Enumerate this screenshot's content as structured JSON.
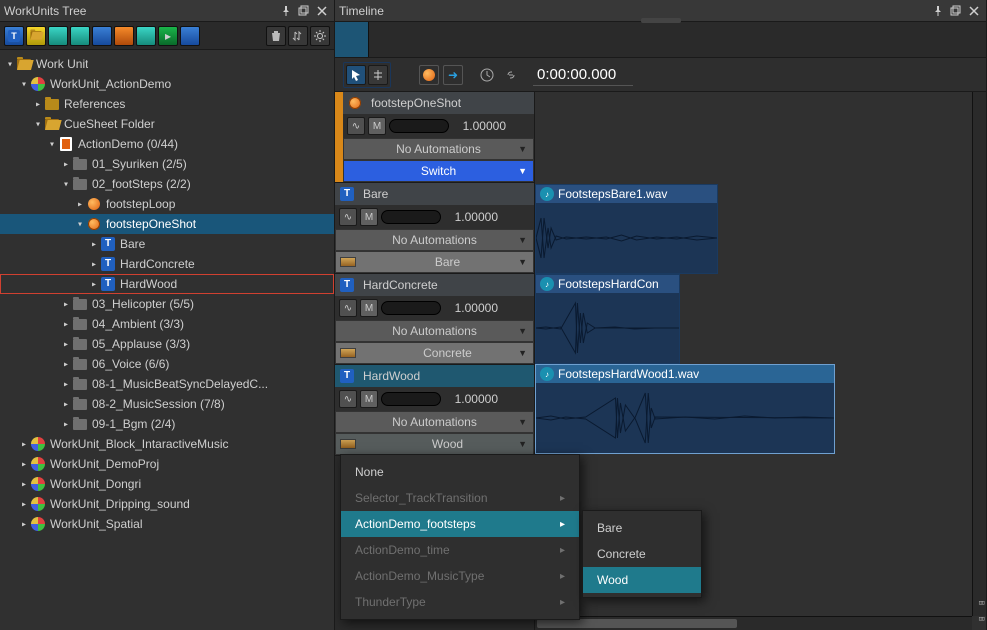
{
  "left": {
    "title": "WorkUnits Tree",
    "tree": {
      "root": "Work Unit",
      "wu_action": "WorkUnit_ActionDemo",
      "references": "References",
      "cuesheet": "CueSheet Folder",
      "actiondemo": "ActionDemo (0/44)",
      "actiondemo_name": "ActionDemo",
      "items": {
        "syuriken": "01_Syuriken (2/5)",
        "footsteps": "02_footSteps (2/2)",
        "footstepLoop": "footstepLoop",
        "footstepOneShot": "footstepOneShot",
        "bare": "Bare",
        "hardConcrete": "HardConcrete",
        "hardWood": "HardWood",
        "helicopter": "03_Helicopter (5/5)",
        "ambient": "04_Ambient (3/3)",
        "applause": "05_Applause (3/3)",
        "voice": "06_Voice (6/6)",
        "musicbeat": "08-1_MusicBeatSyncDelayedC...",
        "musicsession": "08-2_MusicSession (7/8)",
        "bgm": "09-1_Bgm (2/4)"
      },
      "wu_block": "WorkUnit_Block_IntaractiveMusic",
      "wu_demo": "WorkUnit_DemoProj",
      "wu_dongri": "WorkUnit_Dongri",
      "wu_drip": "WorkUnit_Dripping_sound",
      "wu_spatial": "WorkUnit_Spatial"
    }
  },
  "right": {
    "title": "Timeline",
    "timecode": "0:00:00.000",
    "tracks": [
      {
        "name": "footstepOneShot",
        "value": "1.00000",
        "automations": "No Automations",
        "switchLabel": "Switch"
      },
      {
        "name": "Bare",
        "value": "1.00000",
        "automations": "No Automations",
        "selector": "Bare",
        "clipName": "FootstepsBare1.wav"
      },
      {
        "name": "HardConcrete",
        "value": "1.00000",
        "automations": "No Automations",
        "selector": "Concrete",
        "clipName": "FootstepsHardCon"
      },
      {
        "name": "HardWood",
        "value": "1.00000",
        "automations": "No Automations",
        "selector": "Wood",
        "clipName": "FootstepsHardWood1.wav"
      }
    ],
    "menu": {
      "none": "None",
      "items": [
        "Selector_TrackTransition",
        "ActionDemo_footsteps",
        "ActionDemo_time",
        "ActionDemo_MusicType",
        "ThunderType"
      ],
      "sub": [
        "Bare",
        "Concrete",
        "Wood"
      ]
    }
  },
  "mute_label": "M",
  "track_icon_letter": "T"
}
